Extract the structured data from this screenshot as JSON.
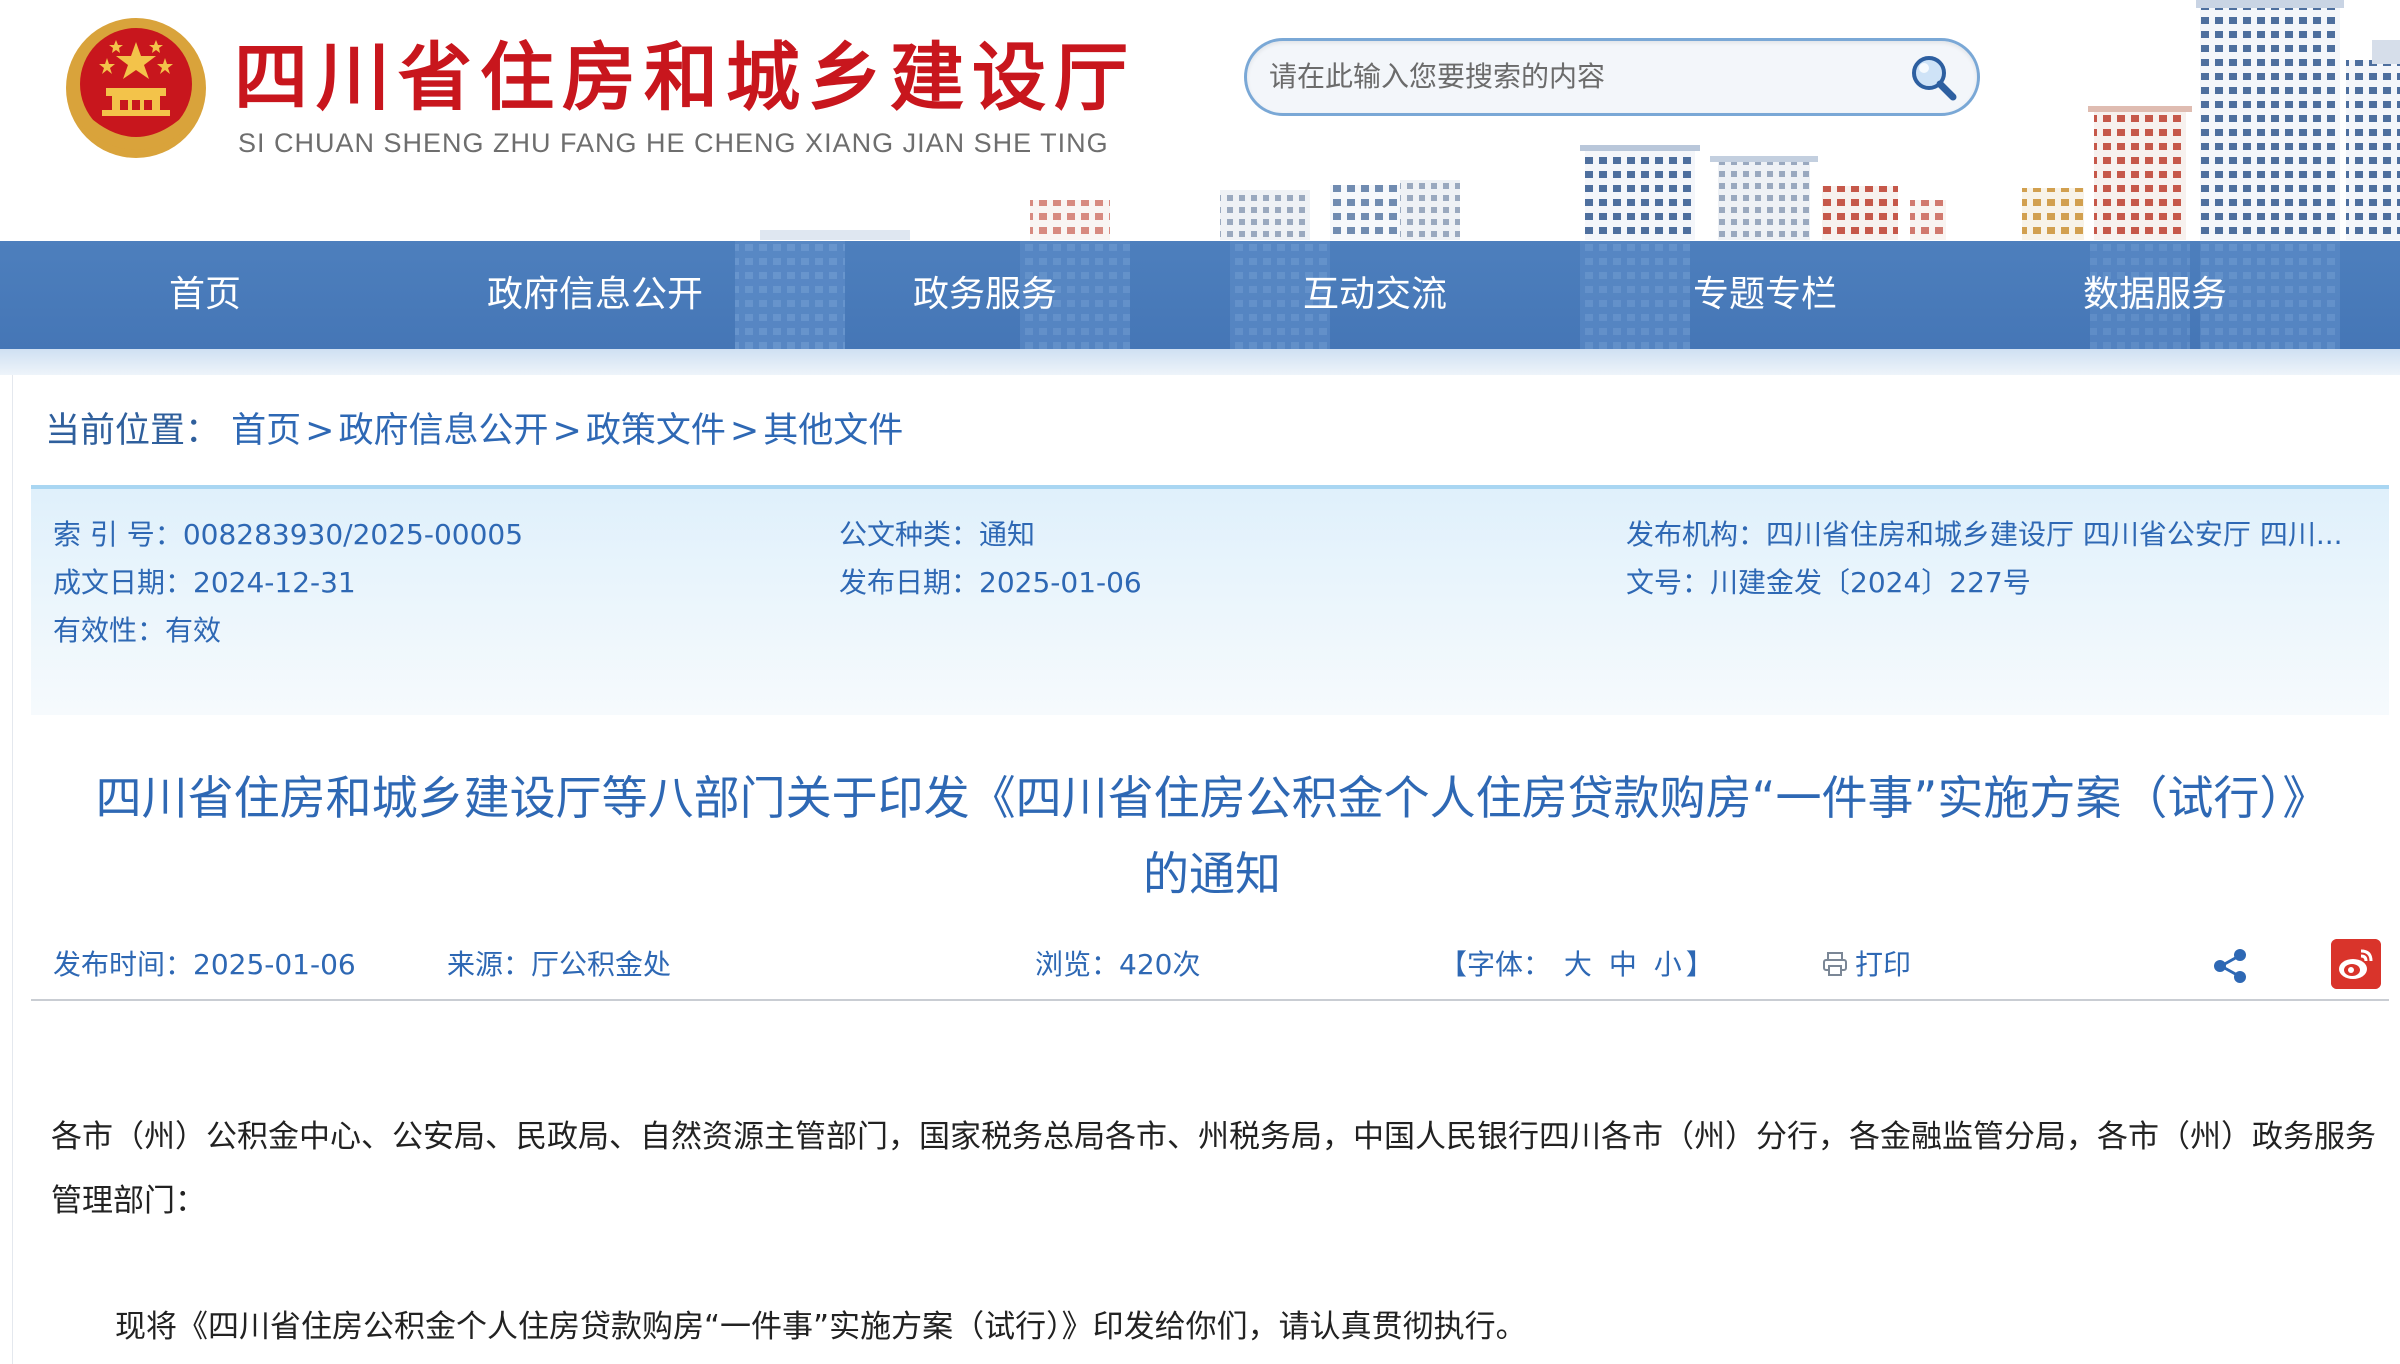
{
  "header": {
    "title": "四川省住房和城乡建设厅",
    "pinyin": "SI CHUAN SHENG ZHU FANG HE CHENG XIANG JIAN SHE TING",
    "emblem_icon": "national-emblem-icon",
    "search_placeholder": "请在此输入您要搜索的内容",
    "search_icon": "magnifier-icon"
  },
  "nav": {
    "items": [
      {
        "label": "首页"
      },
      {
        "label": "政府信息公开"
      },
      {
        "label": "政务服务"
      },
      {
        "label": "互动交流"
      },
      {
        "label": "专题专栏"
      },
      {
        "label": "数据服务"
      }
    ]
  },
  "breadcrumb": {
    "label": "当前位置：",
    "items": [
      "首页",
      "政府信息公开",
      "政策文件",
      "其他文件"
    ],
    "separator": ">"
  },
  "info": {
    "index_key": "索 引 号：",
    "index_val": "008283930/2025-00005",
    "doctype_key": "公文种类：",
    "doctype_val": "通知",
    "issuer_key": "发布机构：",
    "issuer_val": "四川省住房和城乡建设厅 四川省公安厅 四川...",
    "created_key": "成文日期：",
    "created_val": "2024-12-31",
    "published_key": "发布日期：",
    "published_val": "2025-01-06",
    "docno_key": "文号：",
    "docno_val": "川建金发〔2024〕227号",
    "validity_key": "有效性：",
    "validity_val": "有效"
  },
  "article": {
    "title_line1": "四川省住房和城乡建设厅等八部门关于印发《四川省住房公积金个人住房贷款购房“一件事”实施方案（试行）》",
    "title_line2": "的通知",
    "pub_time": "发布时间：2025-01-06",
    "source": "来源：厅公积金处",
    "views": "浏览：420次",
    "font_label_open": "【字体：",
    "font_large": "大",
    "font_medium": "中",
    "font_small": "小",
    "font_label_close": "】",
    "print_label": "打印",
    "share_icon": "share-icon",
    "weibo_icon": "weibo-icon",
    "paragraph1": "各市（州）公积金中心、公安局、民政局、自然资源主管部门，国家税务总局各市、州税务局，中国人民银行四川各市（州）分行，各金融监管分局，各市（州）政务服务管理部门：",
    "paragraph2": "现将《四川省住房公积金个人住房贷款购房“一件事”实施方案（试行）》印发给你们，请认真贯彻执行。"
  },
  "colors": {
    "title_red": "#c8161d",
    "nav_blue": "#4a7cbb",
    "link_blue": "#2e68b4",
    "info_bg": "#e3f2fb"
  }
}
